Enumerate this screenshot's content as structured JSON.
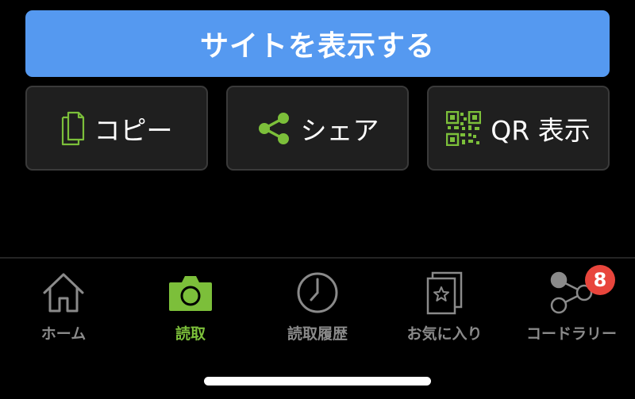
{
  "primary_action": {
    "label": "サイトを表示する"
  },
  "actions": [
    {
      "label": "コピー",
      "icon": "copy-icon"
    },
    {
      "label": "シェア",
      "icon": "share-icon"
    },
    {
      "label": "QR 表示",
      "icon": "qr-code-icon"
    }
  ],
  "tabbar": {
    "items": [
      {
        "label": "ホーム",
        "icon": "home-icon",
        "active": false
      },
      {
        "label": "読取",
        "icon": "camera-icon",
        "active": true
      },
      {
        "label": "読取履歴",
        "icon": "clock-icon",
        "active": false
      },
      {
        "label": "お気に入り",
        "icon": "favorites-card-icon",
        "active": false
      },
      {
        "label": "コードラリー",
        "icon": "code-rally-icon",
        "active": false,
        "badge": "8"
      }
    ]
  },
  "colors": {
    "primary": "#5599f0",
    "accent_green": "#7cbf3a",
    "inactive": "#8a8a8a",
    "badge": "#e8453c"
  }
}
